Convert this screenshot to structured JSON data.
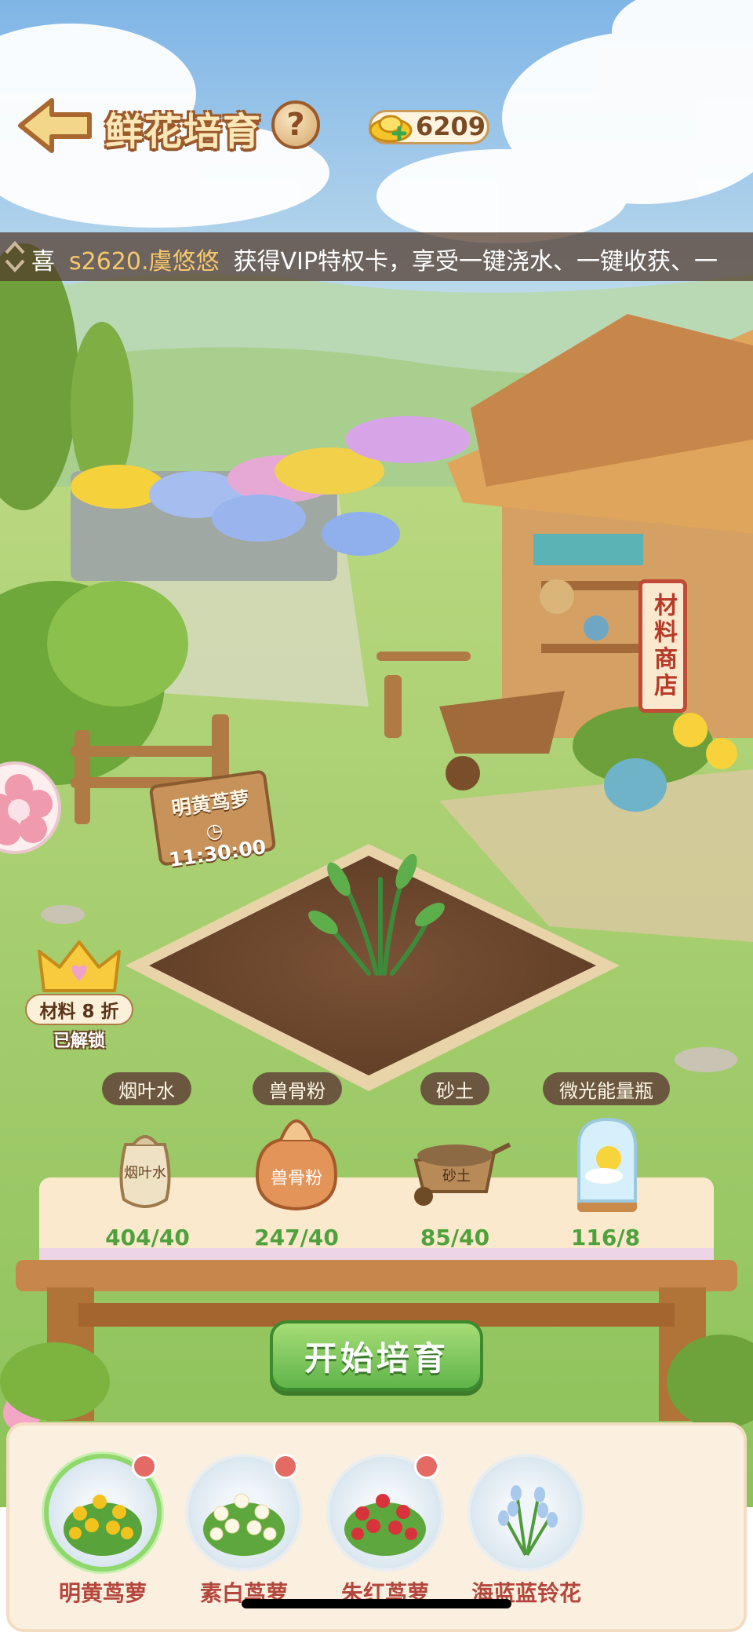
{
  "header": {
    "title": "鲜花培育",
    "help_label": "?",
    "currency_value": "6209"
  },
  "announcement": {
    "prefix": "喜",
    "player_name": "s2620.虞悠悠",
    "message": "获得VIP特权卡，享受一键浇水、一键收获、一"
  },
  "shop_sign": "材料商店",
  "plant_sign": {
    "name": "明黄茑萝",
    "timer": "11:30:00"
  },
  "vip_badge": {
    "discount": "材料 8 折",
    "status": "已解锁"
  },
  "materials": [
    {
      "name": "烟叶水",
      "count": "404/40",
      "icon": "tobacco-water-bag-icon"
    },
    {
      "name": "兽骨粉",
      "count": "247/40",
      "icon": "bone-powder-sack-icon"
    },
    {
      "name": "砂土",
      "count": "85/40",
      "icon": "sand-soil-cart-icon"
    },
    {
      "name": "微光能量瓶",
      "count": "116/8",
      "icon": "glow-energy-jar-icon"
    }
  ],
  "start_button": "开始培育",
  "flowers": [
    {
      "name": "明黄茑萝",
      "selected": true,
      "has_dot": true,
      "color": "#f2c21e"
    },
    {
      "name": "素白茑萝",
      "selected": false,
      "has_dot": true,
      "color": "#fdf7e6"
    },
    {
      "name": "朱红茑萝",
      "selected": false,
      "has_dot": true,
      "color": "#d8323b"
    },
    {
      "name": "海蓝蓝铃花",
      "selected": false,
      "has_dot": false,
      "color": "#a8c8ec"
    }
  ]
}
